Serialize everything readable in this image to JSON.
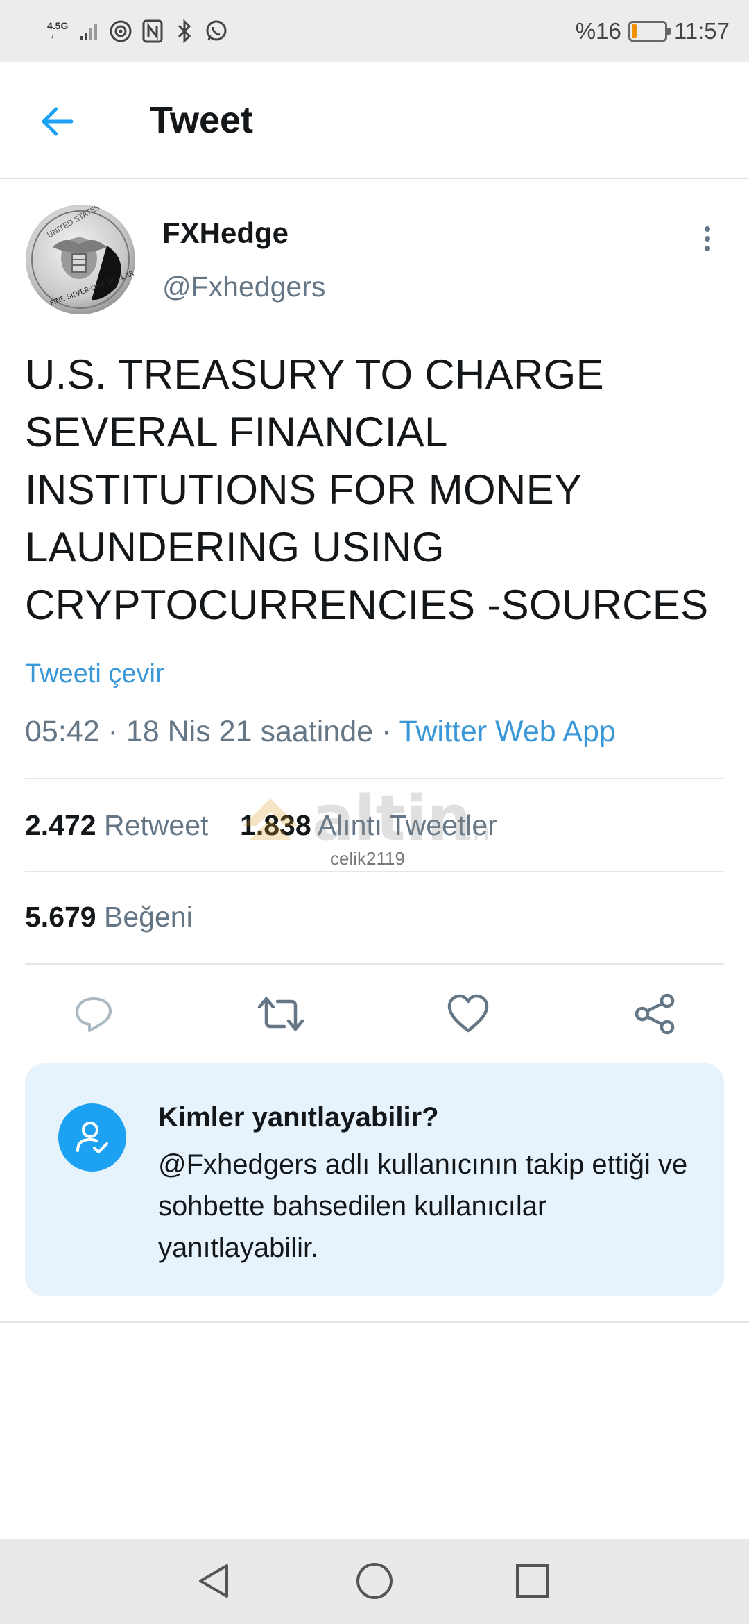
{
  "status_bar": {
    "network": "4.5G",
    "battery_text": "%16",
    "battery_level": 0.16,
    "battery_color": "#f39200",
    "time": "11:57",
    "icons": [
      "signal-icon",
      "hotspot-icon",
      "nfc-icon",
      "bluetooth-icon",
      "whatsapp-icon"
    ]
  },
  "header": {
    "title": "Tweet",
    "back_icon": "arrow-left-icon"
  },
  "tweet": {
    "author_name": "FXHedge",
    "author_handle": "@Fxhedgers",
    "avatar_icon": "silver-eagle-coin-avatar",
    "text": "U.S. TREASURY TO CHARGE\nSEVERAL FINANCIAL\nINSTITUTIONS FOR MONEY\nLAUNDERING USING\nCRYPTOCURRENCIES  -SOURCES",
    "translate_label": "Tweeti çevir",
    "time": "05:42",
    "separator": "·",
    "date": "18 Nis 21 saatinde",
    "app": "Twitter Web App"
  },
  "stats": {
    "retweets_count": "2.472",
    "retweets_label": "Retweet",
    "quotes_count": "1.838",
    "quotes_label": "Alıntı Tweetler",
    "likes_count": "5.679",
    "likes_label": "Beğeni"
  },
  "watermark": {
    "brand": "altin",
    "suffix": "in",
    "user": "celik2119"
  },
  "actions": [
    "reply-icon",
    "retweet-icon",
    "like-icon",
    "share-icon"
  ],
  "reply_card": {
    "title": "Kimler yanıtlayabilir?",
    "description": "@Fxhedgers adlı kullanıcının takip ettiği ve sohbette bahsedilen kullanıcılar yanıtlayabilir."
  },
  "nav_bar": [
    "back-triangle-icon",
    "home-circle-icon",
    "recents-square-icon"
  ],
  "colors": {
    "accent": "#1da1f2",
    "link": "#3a98d8",
    "muted": "#657786",
    "card_bg": "#e6f3fd"
  }
}
